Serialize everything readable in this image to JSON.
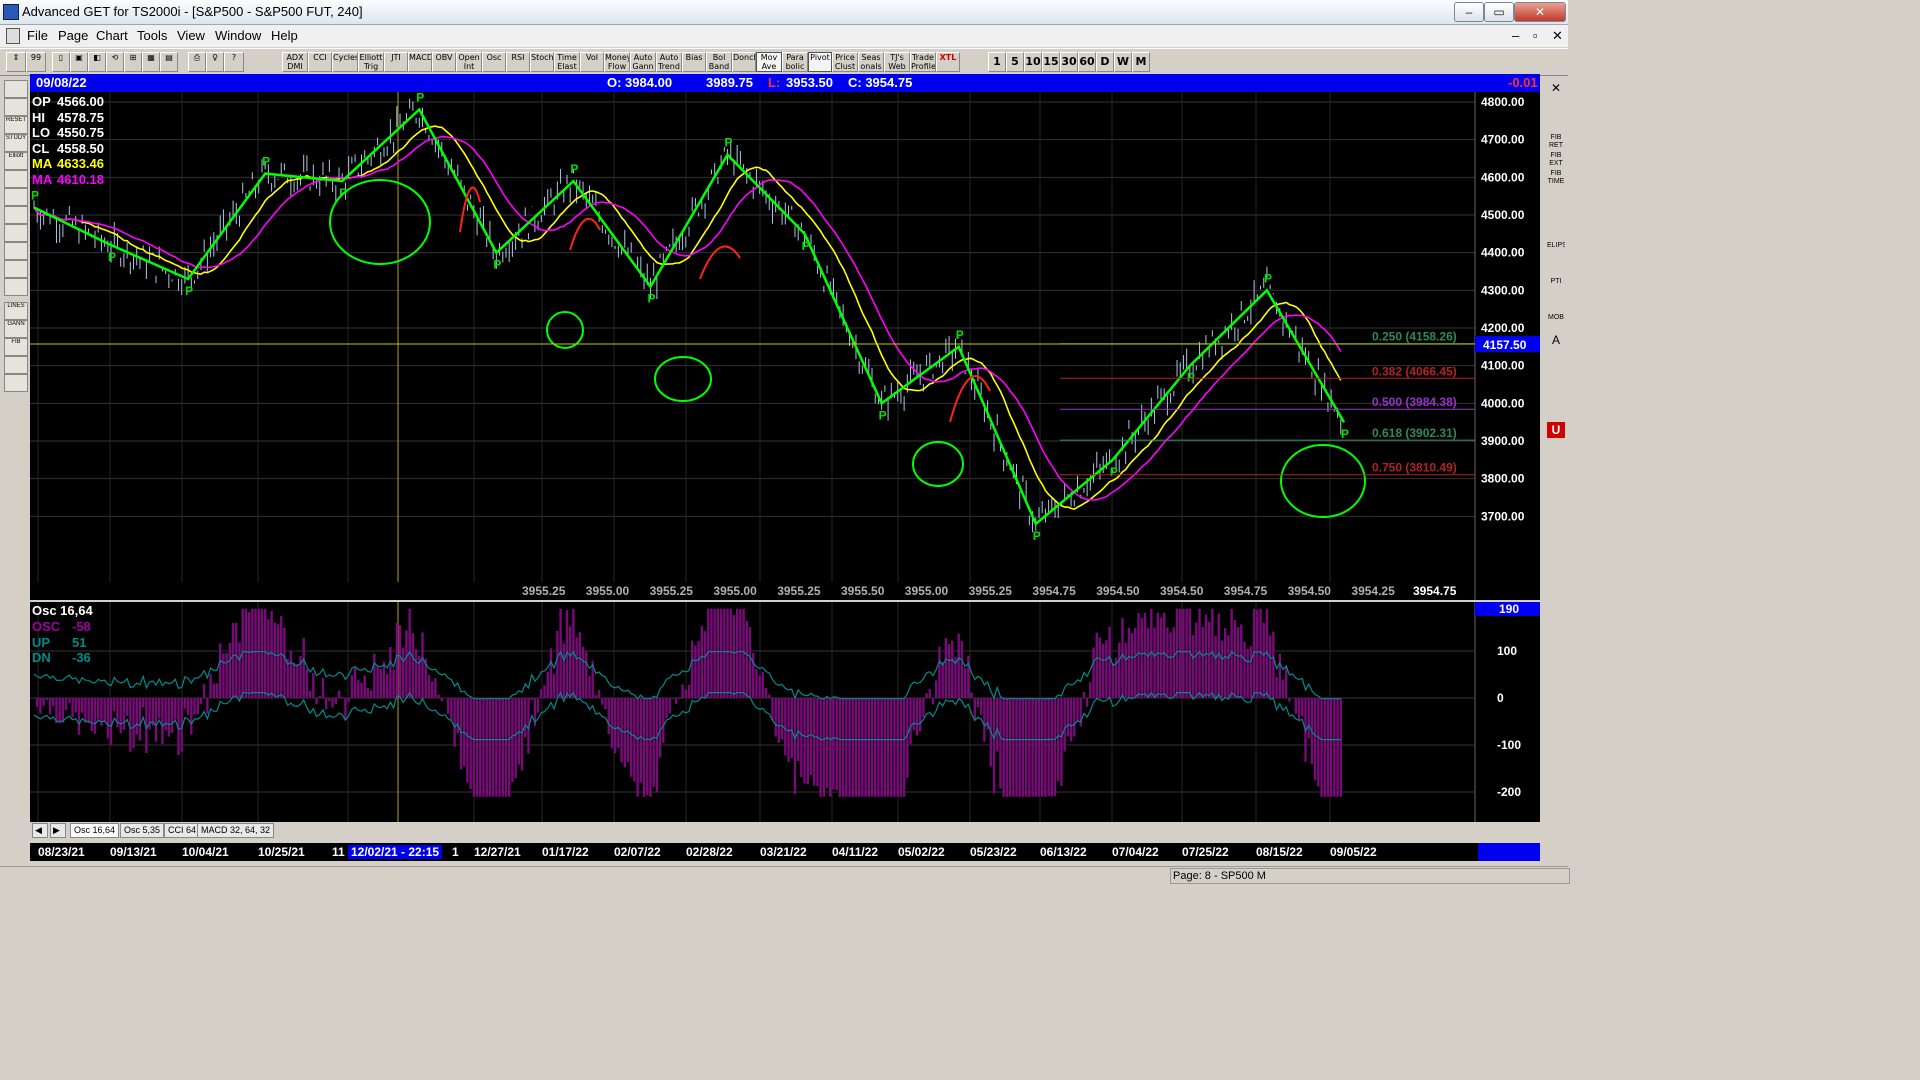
{
  "window": {
    "title": "Advanced GET for TS2000i - [S&P500 - S&P500 FUT, 240]",
    "controls": [
      "–",
      "▭",
      "✕"
    ]
  },
  "menu": {
    "items": [
      "File",
      "Page",
      "Chart",
      "Tools",
      "View",
      "Window",
      "Help"
    ],
    "mdi_controls": [
      "–",
      "▫",
      "✕"
    ]
  },
  "toolbar": {
    "study_buttons": [
      "ADX DMI",
      "CCI",
      "Cycles",
      "Elliott Trig",
      "JTI",
      "MACD",
      "OBV",
      "Open Int",
      "Osc",
      "RSI",
      "Stoch",
      "Time Elast",
      "Vol",
      "Money Flow",
      "Auto Gann",
      "Auto Trend",
      "Bias",
      "Bol Band",
      "Donch",
      "Mov Ave",
      "Para bolic",
      "Pivot",
      "Price Clust",
      "Seas onals",
      "TJ's Web",
      "Trade Profile",
      "XTL"
    ],
    "period_buttons": [
      "1",
      "5",
      "10",
      "15",
      "30",
      "60",
      "D",
      "W",
      "M"
    ]
  },
  "left_tools": [
    "",
    "",
    "RESET",
    "STUDY",
    "Elliott",
    "",
    "",
    "",
    "",
    "",
    "",
    "",
    "LINES",
    "GANN",
    "FIB",
    "",
    ""
  ],
  "right_tools": [
    "✕",
    "",
    "",
    "FIB RET",
    "FIB EXT",
    "FIB TIME",
    "",
    "",
    "",
    "ELIPS",
    "",
    "PTI",
    "",
    "MOB",
    "A",
    "",
    "",
    "",
    "",
    "U"
  ],
  "info": {
    "date": "09/08/22",
    "open": "O: 3984.00",
    "high": "3989.75",
    "low_label": "L:",
    "low": "3953.50",
    "close": "C: 3954.75",
    "change": "-0.01"
  },
  "legend": {
    "op": {
      "label": "OP",
      "value": "4566.00",
      "color": "#ffffff"
    },
    "hi": {
      "label": "HI",
      "value": "4578.75",
      "color": "#ffffff"
    },
    "lo": {
      "label": "LO",
      "value": "4550.75",
      "color": "#ffffff"
    },
    "cl": {
      "label": "CL",
      "value": "4558.50",
      "color": "#ffffff"
    },
    "ma1": {
      "label": "MA",
      "value": "4633.46",
      "color": "#ffff00"
    },
    "ma2": {
      "label": "MA",
      "value": "4610.18",
      "color": "#ff00ff"
    }
  },
  "price_axis": [
    "4800.00",
    "4700.00",
    "4600.00",
    "4500.00",
    "4400.00",
    "4300.00",
    "4200.00",
    "4100.00",
    "4000.00",
    "3900.00",
    "3800.00",
    "3700.00"
  ],
  "current_price": "4157.50",
  "fib_levels": [
    {
      "label": "0.250 (4158.26)",
      "price": 4158.26,
      "color": "#2e8b57"
    },
    {
      "label": "0.382 (4066.45)",
      "price": 4066.45,
      "color": "#b22222"
    },
    {
      "label": "0.500 (3984.38)",
      "price": 3984.38,
      "color": "#9932cc"
    },
    {
      "label": "0.618 (3902.31)",
      "price": 3902.31,
      "color": "#2e8b57"
    },
    {
      "label": "0.750 (3810.49)",
      "price": 3810.49,
      "color": "#b22222"
    }
  ],
  "bottom_values": [
    "3955.25",
    "3955.00",
    "3955.25",
    "3955.00",
    "3955.25",
    "3955.50",
    "3955.00",
    "3955.25",
    "3954.75",
    "3954.50",
    "3954.50",
    "3954.75",
    "3954.50",
    "3954.25"
  ],
  "bottom_value_last": "3954.75",
  "osc_title": "Osc 16,64",
  "osc_legend": {
    "osc": {
      "label": "OSC",
      "value": "-58",
      "color": "#a000a0"
    },
    "up": {
      "label": "UP",
      "value": "51",
      "color": "#008b8b"
    },
    "dn": {
      "label": "DN",
      "value": "-36",
      "color": "#008b8b"
    }
  },
  "osc_axis": [
    "100",
    "0",
    "-100",
    "-200"
  ],
  "osc_marker": "190",
  "tabs": [
    "Osc 16,64",
    "Osc 5,35",
    "CCI 64",
    "MACD 32, 64, 32"
  ],
  "dates": [
    "08/23/21",
    "09/13/21",
    "10/04/21",
    "10/25/21",
    "11",
    "12/02/21 - 22:15",
    "1",
    "12/27/21",
    "01/17/22",
    "02/07/22",
    "02/28/22",
    "03/21/22",
    "04/11/22",
    "05/02/22",
    "05/23/22",
    "06/13/22",
    "07/04/22",
    "07/25/22",
    "08/15/22",
    "09/05/22"
  ],
  "status": {
    "page": "Page: 8 - SP500 M"
  },
  "pivot_label": "P",
  "colors": {
    "background": "#000000",
    "info_bar": "#0000f0",
    "bars": "#a8c8e8",
    "ma_fast": "#ffff00",
    "ma_slow": "#ff00ff",
    "drawing_green": "#00ff00",
    "drawing_red": "#ff2020",
    "osc_fill": "#7a0a7a"
  },
  "chart_data": {
    "type": "line",
    "x": [
      "08/23/21",
      "09/13/21",
      "10/04/21",
      "10/25/21",
      "12/02/21",
      "12/27/21",
      "01/17/22",
      "02/07/22",
      "02/28/22",
      "03/21/22",
      "04/11/22",
      "05/02/22",
      "05/23/22",
      "06/13/22",
      "07/04/22",
      "07/25/22",
      "08/15/22",
      "09/05/22"
    ],
    "series": [
      {
        "values": [
          4520,
          4420,
          4330,
          4610,
          4590,
          4780,
          4400,
          4590,
          4310,
          4660,
          4450,
          4000,
          4150,
          3680,
          3850,
          4100,
          4300,
          3950
        ]
      }
    ],
    "ylim": [
      3620,
      4820
    ]
  }
}
